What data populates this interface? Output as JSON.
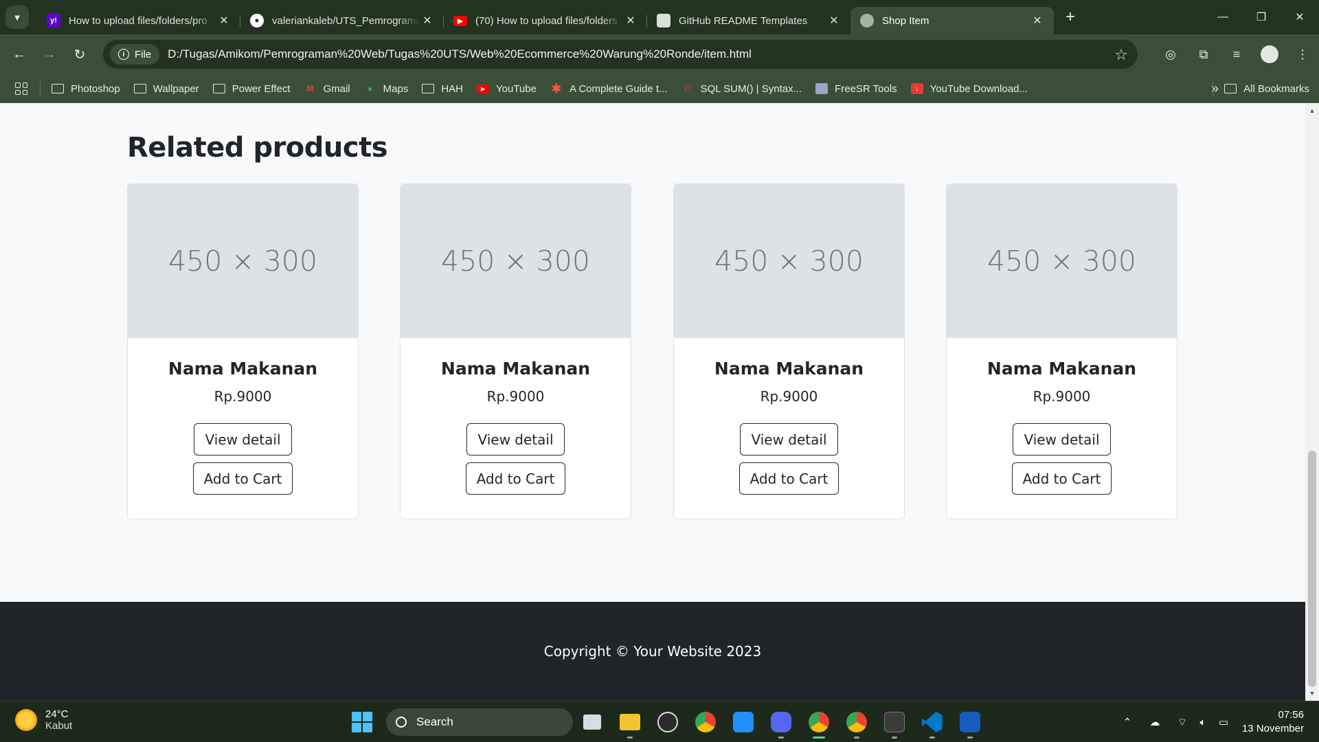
{
  "browser": {
    "tabs": [
      {
        "title": "How to upload files/folders/pro",
        "favicon_color": "#6001d2",
        "favicon_glyph": "y!",
        "active": false
      },
      {
        "title": "valeriankaleb/UTS_Pemrograma",
        "favicon_color": "#ffffff",
        "favicon_glyph": "",
        "active": false
      },
      {
        "title": "(70) How to upload files/folders",
        "favicon_color": "#ff0000",
        "favicon_glyph": "▶",
        "active": false
      },
      {
        "title": "GitHub README Templates",
        "favicon_color": "#d9e0d6",
        "favicon_glyph": "",
        "active": false
      },
      {
        "title": "Shop Item",
        "favicon_color": "#a7b3a4",
        "favicon_glyph": "",
        "active": true
      }
    ],
    "address": {
      "chip_label": "File",
      "url": "D:/Tugas/Amikom/Pemrograman%20Web/Tugas%20UTS/Web%20Ecommerce%20Warung%20Ronde/item.html"
    },
    "bookmarks": [
      {
        "label": "Photoshop",
        "icon": "folder-icon"
      },
      {
        "label": "Wallpaper",
        "icon": "folder-icon"
      },
      {
        "label": "Power Effect",
        "icon": "folder-icon"
      },
      {
        "label": "Gmail",
        "icon": "gmail-icon"
      },
      {
        "label": "Maps",
        "icon": "maps-icon"
      },
      {
        "label": "HAH",
        "icon": "folder-icon"
      },
      {
        "label": "YouTube",
        "icon": "youtube-icon"
      },
      {
        "label": "A Complete Guide t...",
        "icon": "asterisk-icon"
      },
      {
        "label": "SQL SUM() | Syntax...",
        "icon": "sql-icon"
      },
      {
        "label": "FreeSR Tools",
        "icon": "freesr-icon"
      },
      {
        "label": "YouTube Download...",
        "icon": "download-icon"
      }
    ],
    "all_bookmarks_label": "All Bookmarks"
  },
  "page": {
    "section_title": "Related products",
    "products": [
      {
        "image_text": "450 × 300",
        "name": "Nama Makanan",
        "price": "Rp.9000",
        "view_label": "View detail",
        "cart_label": "Add to Cart"
      },
      {
        "image_text": "450 × 300",
        "name": "Nama Makanan",
        "price": "Rp.9000",
        "view_label": "View detail",
        "cart_label": "Add to Cart"
      },
      {
        "image_text": "450 × 300",
        "name": "Nama Makanan",
        "price": "Rp.9000",
        "view_label": "View detail",
        "cart_label": "Add to Cart"
      },
      {
        "image_text": "450 × 300",
        "name": "Nama Makanan",
        "price": "Rp.9000",
        "view_label": "View detail",
        "cart_label": "Add to Cart"
      }
    ],
    "footer_text": "Copyright © Your Website 2023"
  },
  "taskbar": {
    "weather_temp": "24°C",
    "weather_desc": "Kabut",
    "search_label": "Search",
    "time": "07:56",
    "date": "13 November"
  },
  "colors": {
    "browser_frame": "#22331f",
    "browser_toolbar": "#3b4e38",
    "footer_bg": "#212529",
    "placeholder_bg": "#dee2e6"
  }
}
